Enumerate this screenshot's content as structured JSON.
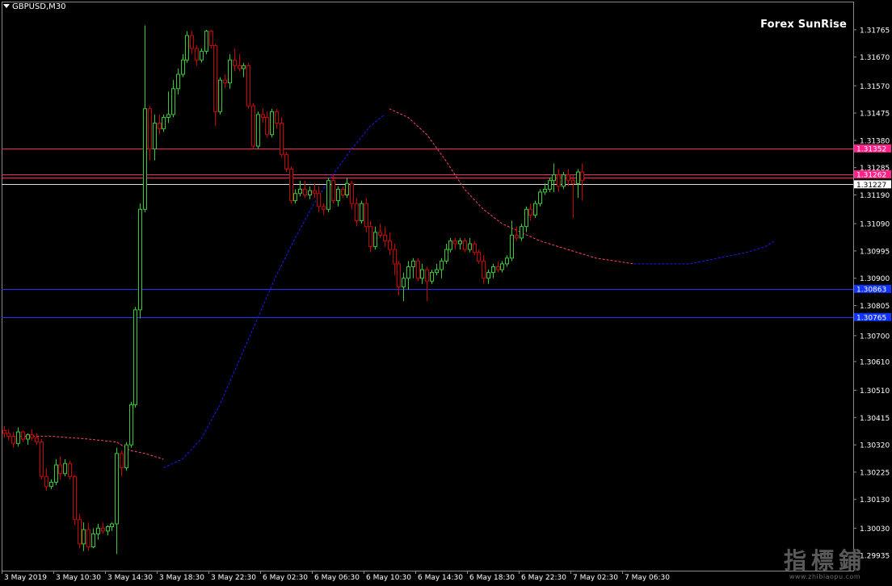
{
  "symbol": {
    "label": "GBPUSD,M30"
  },
  "brand": "Forex SunRise",
  "watermark": {
    "main": "指標鋪",
    "sub": "www.zhibiaopu.com"
  },
  "colors": {
    "background": "#000000",
    "grid_border": "#8a8a8a",
    "text": "#ffffff",
    "bull": "#33cc33",
    "bear": "#cc0000",
    "ma_rising": "#1a1aff",
    "ma_falling": "#ff4466",
    "line_pink": "#ff2266",
    "line_white": "#dddddd",
    "line_blue": "#2233ff",
    "tag_pink": "#ff2288",
    "tag_white": "#ffffff",
    "tag_blue": "#1133ff"
  },
  "chart_data": {
    "type": "candlestick",
    "symbol": "GBPUSD",
    "timeframe": "M30",
    "ylim": [
      1.29882,
      1.31863
    ],
    "grid": false,
    "y_ticks": [
      "1.31765",
      "1.31670",
      "1.31570",
      "1.31475",
      "1.31380",
      "1.31285",
      "1.31190",
      "1.31090",
      "1.30995",
      "1.30900",
      "1.30805",
      "1.30700",
      "1.30610",
      "1.30510",
      "1.30415",
      "1.30320",
      "1.30225",
      "1.30130",
      "1.30030",
      "1.29935"
    ],
    "x_ticks": [
      "3 May 2019",
      "3 May 10:30",
      "3 May 14:30",
      "3 May 18:30",
      "3 May 22:30",
      "6 May 02:30",
      "6 May 06:30",
      "6 May 10:30",
      "6 May 14:30",
      "6 May 18:30",
      "6 May 22:30",
      "7 May 02:30",
      "7 May 06:30"
    ],
    "hlines": [
      {
        "value": 1.31352,
        "label": "1.31352",
        "style": "pink"
      },
      {
        "value": 1.31262,
        "label": "1.31262",
        "style": "pink"
      },
      {
        "value": 1.3125,
        "label": "",
        "style": "pink"
      },
      {
        "value": 1.31227,
        "label": "1.31227",
        "style": "white"
      },
      {
        "value": 1.30863,
        "label": "1.30863",
        "style": "blue"
      },
      {
        "value": 1.30765,
        "label": "1.30765",
        "style": "blue"
      }
    ],
    "candles": [
      [
        1.3037,
        1.30385,
        1.30345,
        1.3036
      ],
      [
        1.3036,
        1.30375,
        1.30335,
        1.3035
      ],
      [
        1.3035,
        1.30365,
        1.3031,
        1.30325
      ],
      [
        1.30325,
        1.3038,
        1.30315,
        1.30365
      ],
      [
        1.30365,
        1.3037,
        1.3033,
        1.3034
      ],
      [
        1.3034,
        1.3036,
        1.3032,
        1.30355
      ],
      [
        1.30355,
        1.30375,
        1.30335,
        1.30345
      ],
      [
        1.30345,
        1.3036,
        1.3032,
        1.3033
      ],
      [
        1.3033,
        1.3034,
        1.302,
        1.3021
      ],
      [
        1.3021,
        1.3024,
        1.3016,
        1.30175
      ],
      [
        1.30175,
        1.302,
        1.30165,
        1.3019
      ],
      [
        1.3019,
        1.3027,
        1.3018,
        1.3025
      ],
      [
        1.3025,
        1.3028,
        1.302,
        1.3022
      ],
      [
        1.3022,
        1.3027,
        1.3021,
        1.30255
      ],
      [
        1.30255,
        1.30265,
        1.302,
        1.3021
      ],
      [
        1.3021,
        1.30215,
        1.3004,
        1.3006
      ],
      [
        1.3006,
        1.3008,
        1.2996,
        1.29975
      ],
      [
        1.29975,
        1.3005,
        1.2995,
        1.30025
      ],
      [
        1.30025,
        1.3005,
        1.2995,
        1.29965
      ],
      [
        1.29965,
        1.3003,
        1.2996,
        1.3001
      ],
      [
        1.3001,
        1.30045,
        1.2999,
        1.3003
      ],
      [
        1.3003,
        1.3005,
        1.3001,
        1.3002
      ],
      [
        1.3002,
        1.3004,
        1.30005,
        1.30035
      ],
      [
        1.30035,
        1.3005,
        1.3002,
        1.30045
      ],
      [
        1.30045,
        1.3031,
        1.2994,
        1.3029
      ],
      [
        1.3029,
        1.303,
        1.3021,
        1.3024
      ],
      [
        1.3024,
        1.3033,
        1.3023,
        1.3032
      ],
      [
        1.3032,
        1.3047,
        1.3031,
        1.3046
      ],
      [
        1.3046,
        1.308,
        1.3045,
        1.3079
      ],
      [
        1.3079,
        1.3116,
        1.3076,
        1.3114
      ],
      [
        1.3114,
        1.3178,
        1.3113,
        1.3149
      ],
      [
        1.3149,
        1.315,
        1.3131,
        1.3135
      ],
      [
        1.3135,
        1.3147,
        1.3131,
        1.3144
      ],
      [
        1.3144,
        1.3147,
        1.314,
        1.3142
      ],
      [
        1.3142,
        1.3147,
        1.3141,
        1.3146
      ],
      [
        1.3146,
        1.3155,
        1.3144,
        1.3147
      ],
      [
        1.3147,
        1.3159,
        1.3146,
        1.3156
      ],
      [
        1.3156,
        1.3163,
        1.3154,
        1.3161
      ],
      [
        1.3161,
        1.3168,
        1.316,
        1.3166
      ],
      [
        1.3166,
        1.3176,
        1.3165,
        1.31745
      ],
      [
        1.31745,
        1.3176,
        1.3168,
        1.317
      ],
      [
        1.317,
        1.3171,
        1.3164,
        1.3166
      ],
      [
        1.3166,
        1.317,
        1.3165,
        1.3169
      ],
      [
        1.3169,
        1.31765,
        1.3168,
        1.3176
      ],
      [
        1.3176,
        1.31765,
        1.317,
        1.3171
      ],
      [
        1.3171,
        1.31715,
        1.3143,
        1.3148
      ],
      [
        1.3148,
        1.316,
        1.3147,
        1.3159
      ],
      [
        1.3159,
        1.3161,
        1.3156,
        1.3158
      ],
      [
        1.3158,
        1.3168,
        1.3156,
        1.3166
      ],
      [
        1.3166,
        1.317,
        1.3162,
        1.3164
      ],
      [
        1.3164,
        1.3168,
        1.3162,
        1.3163
      ],
      [
        1.3163,
        1.3165,
        1.316,
        1.3164
      ],
      [
        1.3164,
        1.3165,
        1.3149,
        1.315
      ],
      [
        1.315,
        1.3151,
        1.3135,
        1.3136
      ],
      [
        1.3136,
        1.3148,
        1.3135,
        1.3147
      ],
      [
        1.3147,
        1.3149,
        1.3144,
        1.3146
      ],
      [
        1.3146,
        1.3148,
        1.3139,
        1.314
      ],
      [
        1.314,
        1.3149,
        1.3139,
        1.3148
      ],
      [
        1.3148,
        1.3149,
        1.3142,
        1.3144
      ],
      [
        1.3144,
        1.3146,
        1.3132,
        1.3133
      ],
      [
        1.3133,
        1.3134,
        1.3127,
        1.3128
      ],
      [
        1.3128,
        1.3129,
        1.3116,
        1.3117
      ],
      [
        1.3117,
        1.3121,
        1.3116,
        1.31195
      ],
      [
        1.31195,
        1.3124,
        1.31185,
        1.3121
      ],
      [
        1.3121,
        1.3124,
        1.3118,
        1.3119
      ],
      [
        1.3119,
        1.3122,
        1.31175,
        1.31205
      ],
      [
        1.31205,
        1.3123,
        1.3118,
        1.31195
      ],
      [
        1.31195,
        1.3122,
        1.3113,
        1.3115
      ],
      [
        1.3115,
        1.3116,
        1.3112,
        1.3114
      ],
      [
        1.3114,
        1.3125,
        1.3113,
        1.3124
      ],
      [
        1.3124,
        1.3126,
        1.3116,
        1.3117
      ],
      [
        1.3117,
        1.3122,
        1.3115,
        1.3121
      ],
      [
        1.3121,
        1.3122,
        1.3118,
        1.3119
      ],
      [
        1.3119,
        1.3125,
        1.3118,
        1.3123
      ],
      [
        1.3123,
        1.3124,
        1.3114,
        1.3116
      ],
      [
        1.3116,
        1.3118,
        1.3108,
        1.311
      ],
      [
        1.311,
        1.3117,
        1.3109,
        1.3116
      ],
      [
        1.3116,
        1.3118,
        1.3106,
        1.3108
      ],
      [
        1.3108,
        1.311,
        1.3099,
        1.3101
      ],
      [
        1.3101,
        1.3108,
        1.31,
        1.3106
      ],
      [
        1.3106,
        1.3109,
        1.3104,
        1.3105
      ],
      [
        1.3105,
        1.3108,
        1.3101,
        1.3103
      ],
      [
        1.3103,
        1.3106,
        1.3098,
        1.31
      ],
      [
        1.31,
        1.3102,
        1.3091,
        1.3095
      ],
      [
        1.3095,
        1.3096,
        1.3084,
        1.3087
      ],
      [
        1.3087,
        1.3092,
        1.3082,
        1.309
      ],
      [
        1.309,
        1.3096,
        1.3086,
        1.3094
      ],
      [
        1.3094,
        1.3097,
        1.309,
        1.3096
      ],
      [
        1.3096,
        1.3097,
        1.3089,
        1.309
      ],
      [
        1.309,
        1.3095,
        1.3088,
        1.3093
      ],
      [
        1.3093,
        1.3094,
        1.3082,
        1.3089
      ],
      [
        1.3089,
        1.3093,
        1.3088,
        1.3092
      ],
      [
        1.3092,
        1.3095,
        1.3091,
        1.3093
      ],
      [
        1.3093,
        1.3097,
        1.309,
        1.3096
      ],
      [
        1.3096,
        1.3102,
        1.3095,
        1.31
      ],
      [
        1.31,
        1.3104,
        1.3099,
        1.3103
      ],
      [
        1.3103,
        1.3104,
        1.31,
        1.3102
      ],
      [
        1.3102,
        1.3104,
        1.31,
        1.3103
      ],
      [
        1.3103,
        1.3104,
        1.3099,
        1.31
      ],
      [
        1.31,
        1.3104,
        1.3099,
        1.3102
      ],
      [
        1.3102,
        1.3103,
        1.3098,
        1.3099
      ],
      [
        1.3099,
        1.31,
        1.3095,
        1.3096
      ],
      [
        1.3096,
        1.3098,
        1.3088,
        1.309
      ],
      [
        1.309,
        1.3093,
        1.3088,
        1.3092
      ],
      [
        1.3092,
        1.3095,
        1.309,
        1.3094
      ],
      [
        1.3094,
        1.3096,
        1.3092,
        1.3093
      ],
      [
        1.3093,
        1.3096,
        1.3092,
        1.3095
      ],
      [
        1.3095,
        1.3098,
        1.3094,
        1.3097
      ],
      [
        1.3097,
        1.311,
        1.3096,
        1.3105
      ],
      [
        1.3105,
        1.3108,
        1.3103,
        1.3104
      ],
      [
        1.3104,
        1.3109,
        1.3103,
        1.3108
      ],
      [
        1.3108,
        1.3115,
        1.3106,
        1.3114
      ],
      [
        1.3114,
        1.3116,
        1.311,
        1.3112
      ],
      [
        1.3112,
        1.3117,
        1.3111,
        1.3116
      ],
      [
        1.3116,
        1.3121,
        1.3115,
        1.312
      ],
      [
        1.312,
        1.3123,
        1.3119,
        1.3121
      ],
      [
        1.3121,
        1.3125,
        1.312,
        1.3124
      ],
      [
        1.3124,
        1.313,
        1.312,
        1.3126
      ],
      [
        1.3126,
        1.3128,
        1.312,
        1.3122
      ],
      [
        1.3122,
        1.3127,
        1.3121,
        1.3126
      ],
      [
        1.3126,
        1.3128,
        1.3122,
        1.3124
      ],
      [
        1.3124,
        1.3126,
        1.3111,
        1.3123
      ],
      [
        1.3123,
        1.3128,
        1.3118,
        1.3127
      ],
      [
        1.3127,
        1.313,
        1.3117,
        1.3124
      ]
    ],
    "ma_falling": [
      [
        1,
        1.3035
      ],
      [
        10,
        1.3035
      ],
      [
        18,
        1.3034
      ],
      [
        24,
        1.3033
      ],
      [
        27,
        1.303
      ],
      [
        30,
        1.3029
      ],
      [
        34,
        1.3027
      ]
    ],
    "ma_rising": [
      [
        34,
        1.3024
      ],
      [
        38,
        1.3027
      ],
      [
        42,
        1.3034
      ],
      [
        46,
        1.3046
      ],
      [
        50,
        1.3061
      ],
      [
        54,
        1.3076
      ],
      [
        58,
        1.3091
      ],
      [
        62,
        1.3104
      ],
      [
        66,
        1.3116
      ],
      [
        70,
        1.3126
      ],
      [
        74,
        1.3135
      ],
      [
        78,
        1.3143
      ],
      [
        81,
        1.3147
      ]
    ],
    "ma_falling_2": [
      [
        82,
        1.3149
      ],
      [
        86,
        1.3146
      ],
      [
        90,
        1.314
      ],
      [
        94,
        1.3131
      ],
      [
        98,
        1.3121
      ],
      [
        102,
        1.3114
      ],
      [
        106,
        1.3109
      ],
      [
        110,
        1.3106
      ],
      [
        114,
        1.3103
      ],
      [
        118,
        1.3101
      ],
      [
        122,
        1.3099
      ],
      [
        126,
        1.3097
      ],
      [
        130,
        1.3096
      ],
      [
        134,
        1.3095
      ]
    ],
    "ma_rising_2": [
      [
        134,
        1.3095
      ],
      [
        140,
        1.3095
      ],
      [
        146,
        1.3095
      ],
      [
        152,
        1.3097
      ],
      [
        158,
        1.3099
      ],
      [
        162,
        1.3101
      ],
      [
        164,
        1.3103
      ]
    ]
  }
}
